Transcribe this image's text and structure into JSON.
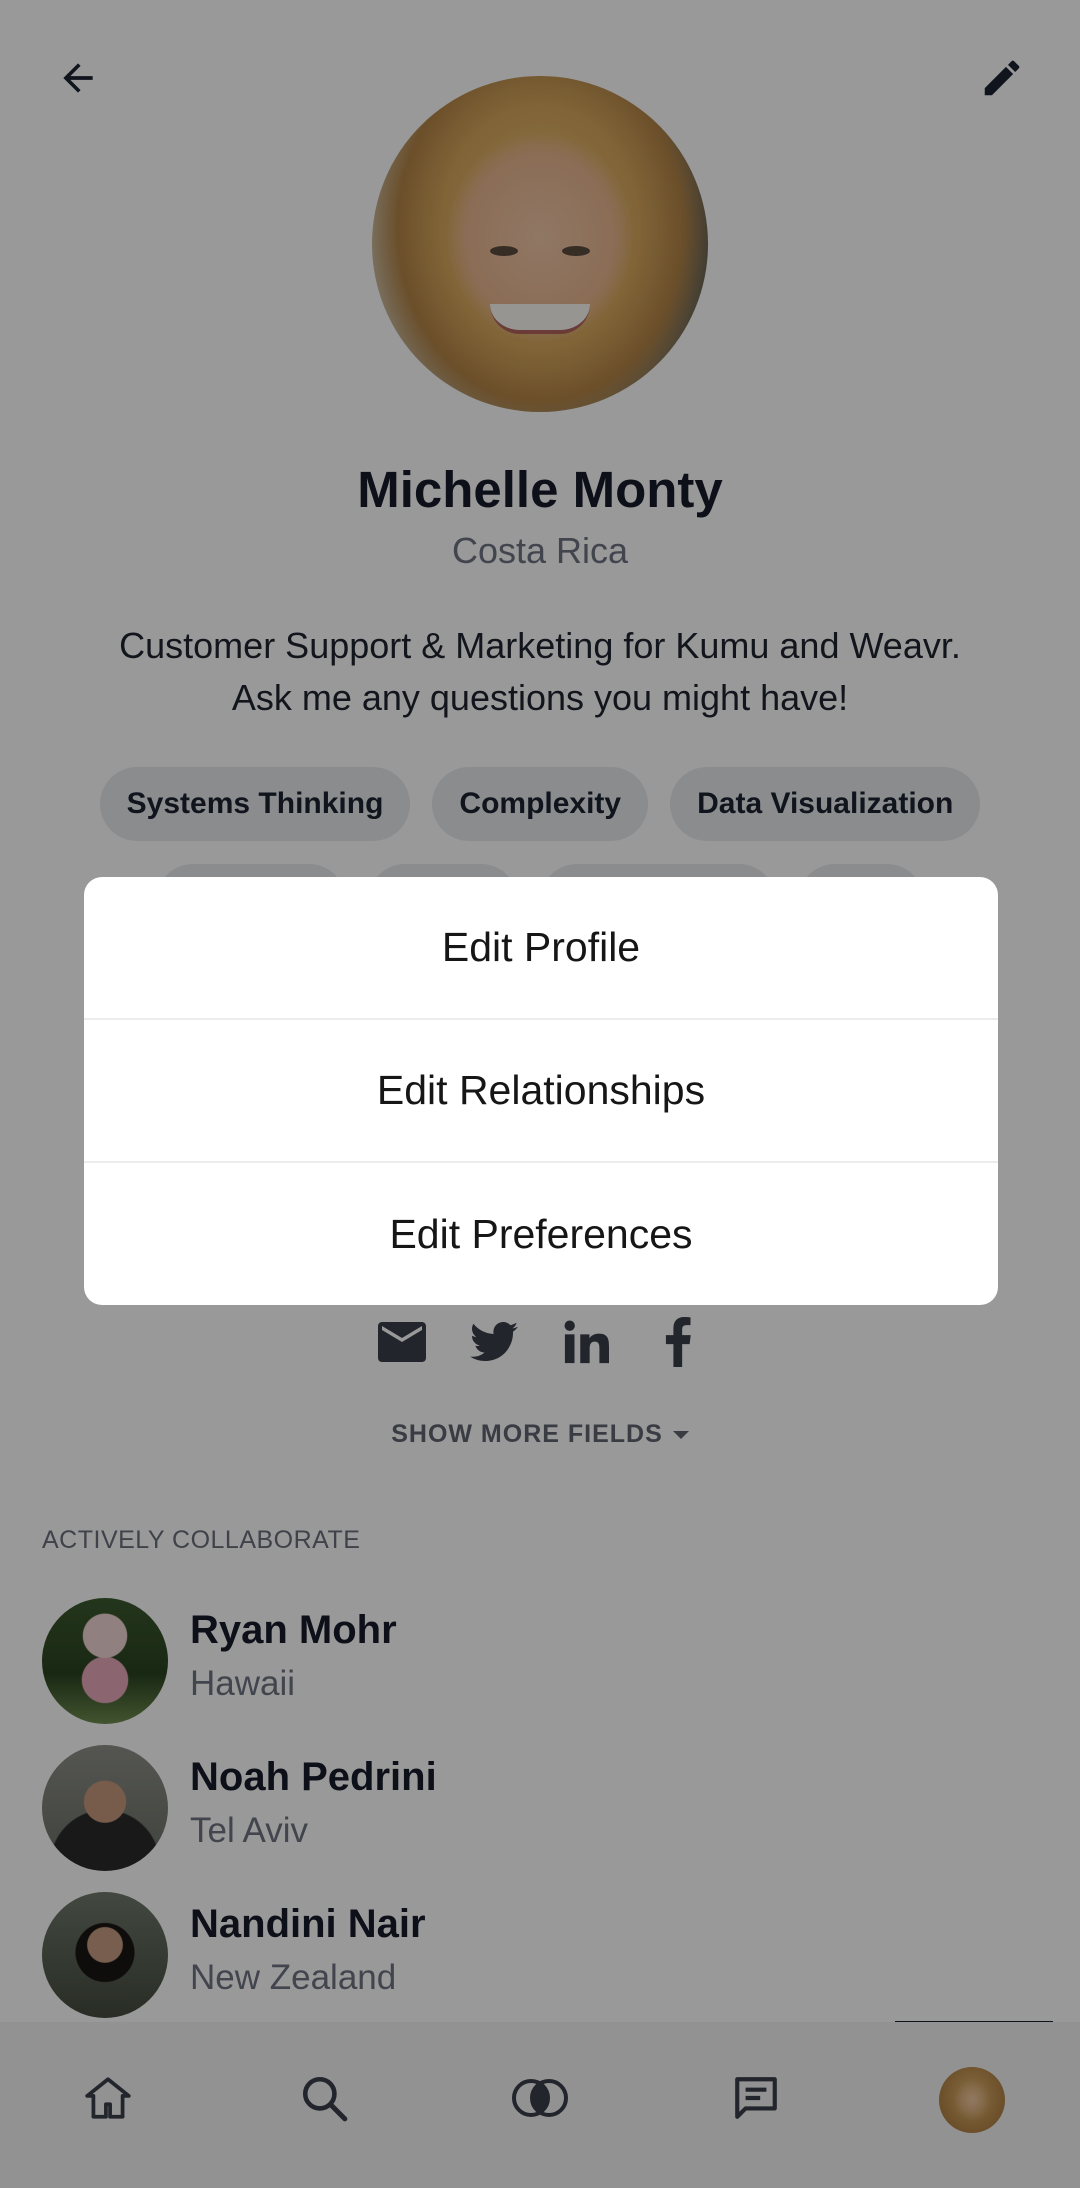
{
  "header": {
    "back_icon": "arrow-left-icon",
    "edit_icon": "pencil-icon"
  },
  "profile": {
    "name": "Michelle Monty",
    "location": "Costa Rica",
    "bio_line1": "Customer Support & Marketing for Kumu and Weavr.",
    "bio_line2": "Ask me any questions you might have!",
    "tags": [
      "Systems Thinking",
      "Complexity",
      "Data Visualization"
    ]
  },
  "social": {
    "icons": [
      "email-icon",
      "twitter-icon",
      "linkedin-icon",
      "facebook-icon"
    ]
  },
  "show_more": {
    "label": "SHOW MORE FIELDS"
  },
  "collaborators": {
    "title": "ACTIVELY COLLABORATE",
    "people": [
      {
        "name": "Ryan Mohr",
        "location": "Hawaii"
      },
      {
        "name": "Noah Pedrini",
        "location": "Tel Aviv"
      },
      {
        "name": "Nandini Nair",
        "location": "New Zealand"
      }
    ]
  },
  "modal": {
    "items": [
      "Edit Profile",
      "Edit Relationships",
      "Edit Preferences"
    ]
  },
  "bottom_nav": {
    "items": [
      "home-icon",
      "search-icon",
      "venn-icon",
      "chat-icon",
      "profile-avatar"
    ]
  },
  "colors": {
    "text_dark": "#161c2a",
    "text_muted": "#6e7380",
    "scrim": "rgba(0,0,0,0.40)"
  }
}
